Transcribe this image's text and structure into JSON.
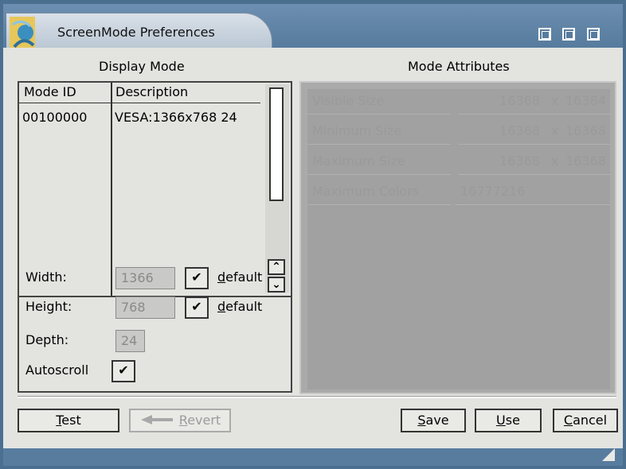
{
  "window": {
    "title": "ScreenMode Preferences",
    "buttons": [
      "zoom-icon",
      "depth-icon",
      "iconify-icon"
    ]
  },
  "display_mode": {
    "title": "Display Mode",
    "columns": [
      "Mode ID",
      "Description"
    ],
    "rows": [
      {
        "mode_id": "00100000",
        "description": "VESA:1366x768 24"
      }
    ],
    "scroll_up": "^",
    "scroll_down": "v"
  },
  "settings": {
    "width_label": "Width:",
    "width_value": "1366",
    "height_label": "Height:",
    "height_value": "768",
    "depth_label": "Depth:",
    "depth_value": "24",
    "autoscroll_label": "Autoscroll",
    "default_label_d": "d",
    "default_label_rest": "efault",
    "check_mark": "✔"
  },
  "mode_attributes": {
    "title": "Mode Attributes",
    "rows": [
      {
        "label": "Visible Size",
        "w": "16368",
        "x": "x",
        "h": "16384"
      },
      {
        "label": "Minimum Size",
        "w": "16368",
        "x": "x",
        "h": "16368"
      },
      {
        "label": "Maximum Size",
        "w": "16368",
        "x": "x",
        "h": "16368"
      },
      {
        "label": "Maximum Colors",
        "w": "16777216",
        "x": "",
        "h": ""
      }
    ]
  },
  "buttons": {
    "test_u": "T",
    "test_rest": "est",
    "revert_u": "R",
    "revert_rest": "evert",
    "save_u": "S",
    "save_rest": "ave",
    "use_u": "U",
    "use_rest": "se",
    "cancel_u": "C",
    "cancel_rest": "ancel"
  }
}
